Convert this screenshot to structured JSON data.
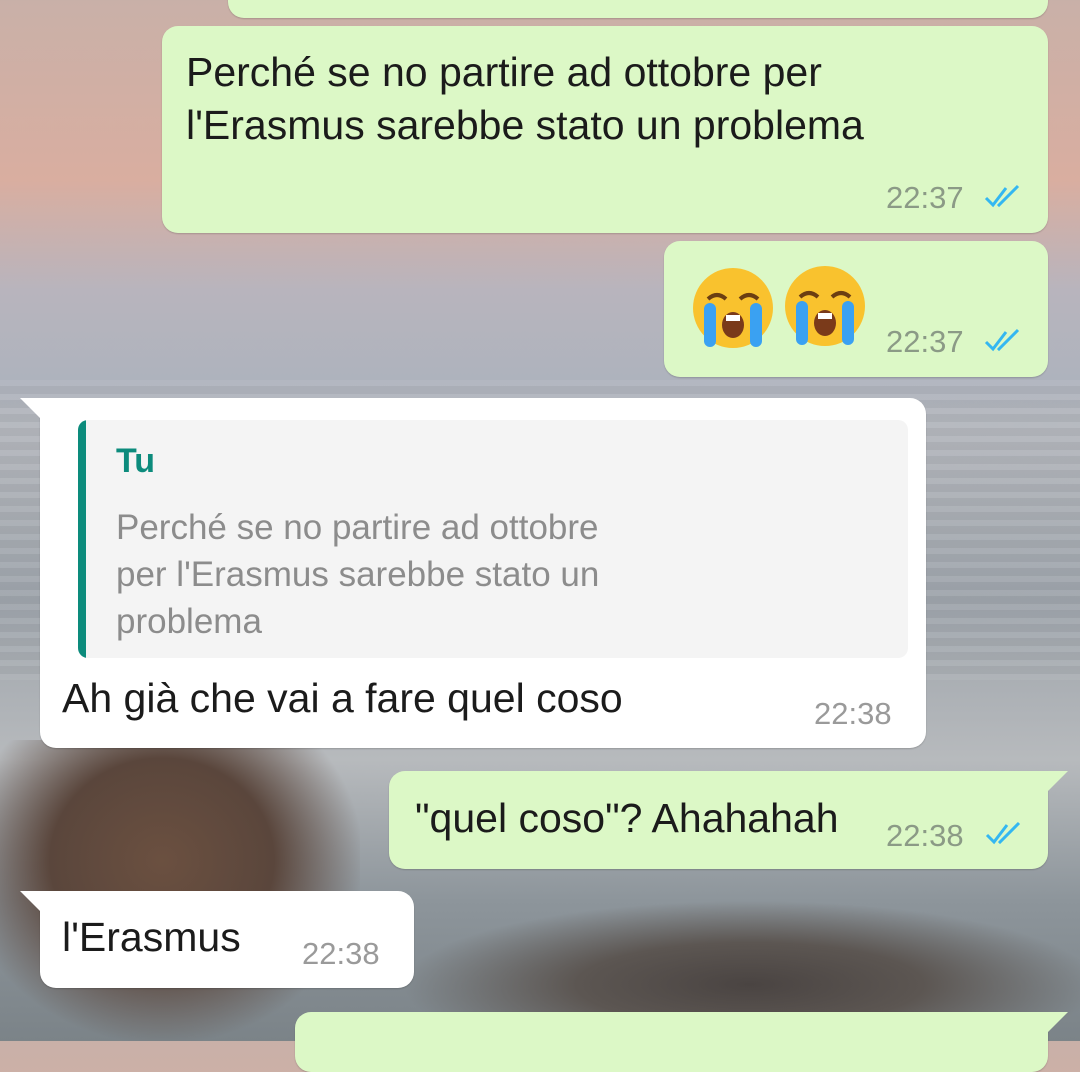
{
  "messages": [
    {
      "id": "m1",
      "direction": "outgoing",
      "text": "Perché se no partire ad ottobre per\nl'Erasmus sarebbe stato un problema",
      "time": "22:37",
      "status": "read"
    },
    {
      "id": "m2",
      "direction": "outgoing",
      "emojis": [
        "loudly-crying-face",
        "loudly-crying-face"
      ],
      "time": "22:37",
      "status": "read"
    },
    {
      "id": "m3",
      "direction": "incoming",
      "reply_to": {
        "author": "Tu",
        "text": "Perché se no partire ad ottobre\nper l'Erasmus sarebbe stato un\nproblema"
      },
      "text": "Ah già che vai a fare quel coso",
      "time": "22:38"
    },
    {
      "id": "m4",
      "direction": "outgoing",
      "text": "\"quel coso\"? Ahahahah",
      "time": "22:38",
      "status": "read"
    },
    {
      "id": "m5",
      "direction": "incoming",
      "text": "l'Erasmus",
      "time": "22:38"
    }
  ],
  "colors": {
    "outgoing_bubble": "#dcf8c6",
    "incoming_bubble": "#ffffff",
    "read_ticks": "#34b7f1",
    "quote_accent": "#0c8b7c"
  }
}
